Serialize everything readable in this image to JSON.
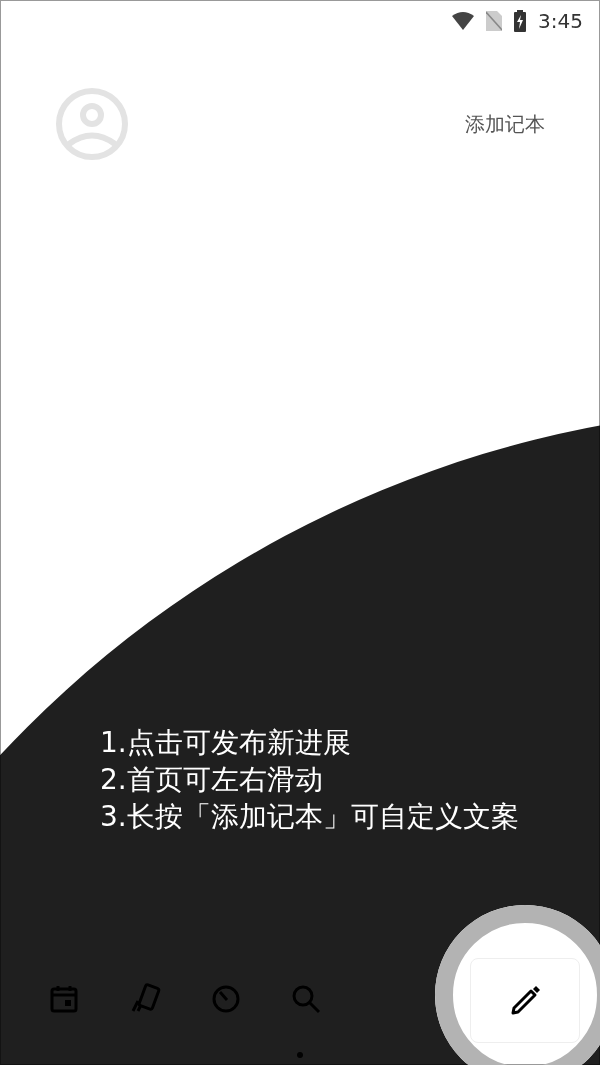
{
  "status_bar": {
    "time": "3:45"
  },
  "header": {
    "action": "添加记本"
  },
  "tutorial": {
    "tips": [
      "1.点击可发布新进展",
      "2.首页可左右滑动",
      "3.长按「添加记本」可自定义文案"
    ]
  }
}
